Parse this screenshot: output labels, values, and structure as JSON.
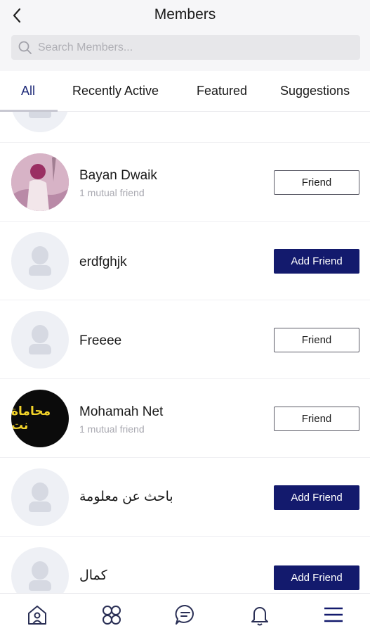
{
  "header": {
    "title": "Members",
    "search_placeholder": "Search Members..."
  },
  "tabs": [
    {
      "label": "All",
      "active": true
    },
    {
      "label": "Recently Active",
      "active": false
    },
    {
      "label": "Featured",
      "active": false
    },
    {
      "label": "Suggestions",
      "active": false
    }
  ],
  "members": [
    {
      "name": "Bayan Dwaik",
      "subtitle": "1 mutual friend",
      "avatar": "photo",
      "button": "Friend"
    },
    {
      "name": "erdfghjk",
      "subtitle": "",
      "avatar": "default",
      "button": "Add Friend"
    },
    {
      "name": "Freeee",
      "subtitle": "",
      "avatar": "default",
      "button": "Friend"
    },
    {
      "name": "Mohamah Net",
      "subtitle": "1 mutual friend",
      "avatar": "logo",
      "avatar_text": "محاماة نت",
      "button": "Friend"
    },
    {
      "name": "باحث عن معلومة",
      "subtitle": "",
      "avatar": "default",
      "button": "Add Friend"
    },
    {
      "name": "كمال",
      "subtitle": "",
      "avatar": "default",
      "button": "Add Friend"
    }
  ],
  "bottom_nav": {
    "items": [
      "home-icon",
      "groups-icon",
      "messages-icon",
      "notifications-icon",
      "menu-icon"
    ]
  },
  "colors": {
    "accent": "#131a6d",
    "active_tab": "#1e2a78",
    "header_bg": "#f6f6f8",
    "search_bg": "#e7e7ea"
  }
}
